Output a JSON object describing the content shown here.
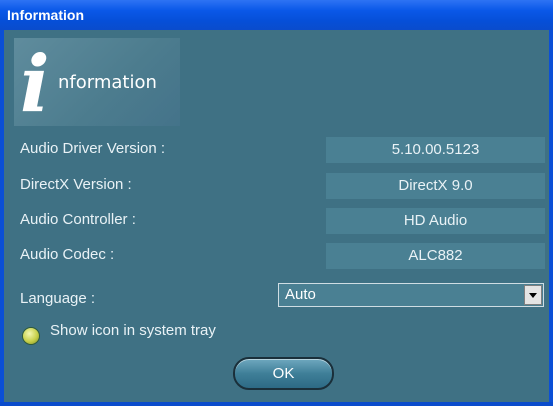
{
  "window": {
    "title": "Information"
  },
  "logo": {
    "big_letter": "i",
    "word": "nformation"
  },
  "rows": [
    {
      "label": "Audio Driver Version :",
      "value": "5.10.00.5123"
    },
    {
      "label": "DirectX Version :",
      "value": "DirectX 9.0"
    },
    {
      "label": "Audio Controller :",
      "value": "HD Audio"
    },
    {
      "label": "Audio Codec :",
      "value": "ALC882"
    }
  ],
  "language": {
    "label": "Language :",
    "selected": "Auto"
  },
  "tray": {
    "label": "Show icon in system tray"
  },
  "buttons": {
    "ok": "OK"
  },
  "colors": {
    "titlebar": "#0a58e8",
    "panel": "#3f7184",
    "value_box": "#4a8093",
    "text": "#e9f2f6"
  }
}
